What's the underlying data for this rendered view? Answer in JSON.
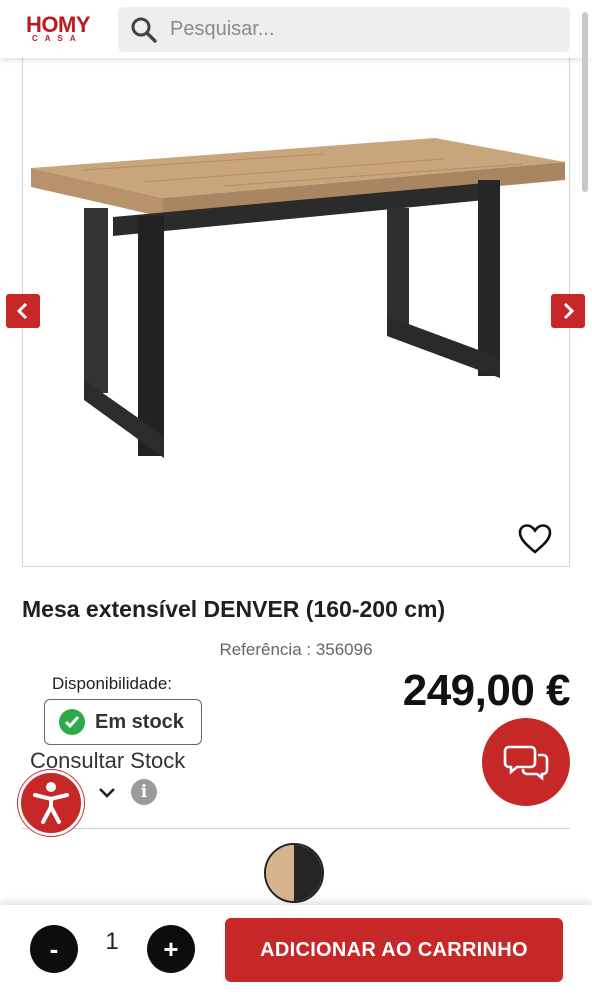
{
  "header": {
    "logo_main_ho": "HO",
    "logo_main_my": "MY",
    "logo_sub": "CASA",
    "search_placeholder": "Pesquisar..."
  },
  "product": {
    "title": "Mesa extensível DENVER (160-200 cm)",
    "reference": "Referência : 356096",
    "availability_label": "Disponibilidade:",
    "stock_status": "Em stock",
    "price": "249,00 €",
    "consult_stock": "Consultar Stock",
    "info_glyph": "i",
    "swatch_colors": {
      "left": "#d7b48d",
      "right": "#252525"
    }
  },
  "cart": {
    "minus_label": "-",
    "quantity": "1",
    "plus_label": "+",
    "add_to_cart_label": "ADICIONAR AO CARRINHO"
  },
  "colors": {
    "brand_red": "#c62828",
    "stock_green": "#2eaa4a"
  },
  "icons": [
    "search-icon",
    "chevron-left-icon",
    "chevron-right-icon",
    "heart-icon",
    "check-icon",
    "chat-icon",
    "accessibility-icon",
    "chevron-down-icon",
    "info-icon"
  ]
}
